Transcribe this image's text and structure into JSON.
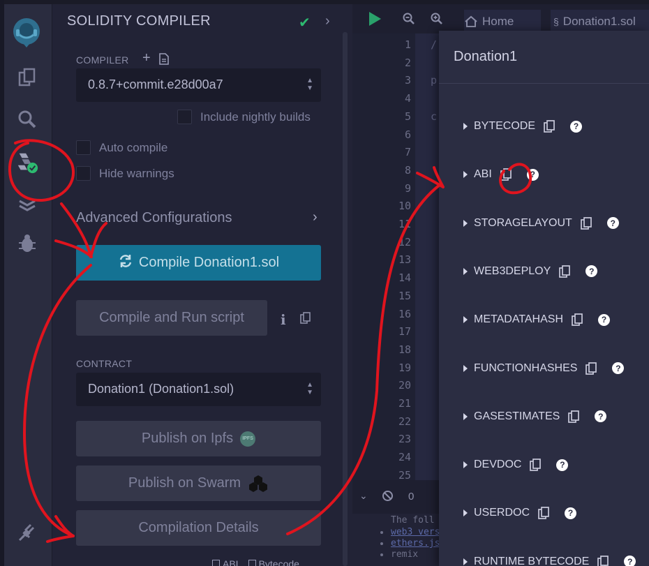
{
  "sidebar": {
    "icons": [
      "remix-logo-icon",
      "file-explorer-icon",
      "search-icon",
      "solidity-compiler-icon",
      "deploy-run-icon",
      "debugger-icon",
      "plugin-manager-icon"
    ]
  },
  "compiler_panel": {
    "title": "SOLIDITY COMPILER",
    "compiler_label": "COMPILER",
    "compiler_version": "0.8.7+commit.e28d00a7",
    "include_nightly_label": "Include nightly builds",
    "auto_compile_label": "Auto compile",
    "hide_warnings_label": "Hide warnings",
    "advanced_label": "Advanced Configurations",
    "compile_button": "Compile Donation1.sol",
    "compile_run_button": "Compile and Run script",
    "contract_label": "CONTRACT",
    "contract_value": "Donation1 (Donation1.sol)",
    "publish_ipfs_button": "Publish on Ipfs",
    "ipfs_badge": "IPFS",
    "publish_swarm_button": "Publish on Swarm",
    "compilation_details_button": "Compilation Details",
    "footer_abi": "ABI",
    "footer_bytecode": "Bytecode"
  },
  "editor": {
    "home_tab": "Home",
    "file_tab": "Donation1.sol",
    "line_numbers": [
      "1",
      "2",
      "3",
      "4",
      "5",
      "6",
      "7",
      "8",
      "9",
      "10",
      "11",
      "12",
      "13",
      "14",
      "15",
      "16",
      "17",
      "18",
      "19",
      "20",
      "21",
      "22",
      "23",
      "24",
      "25"
    ],
    "code_fragments": [
      "/",
      "p",
      "c"
    ],
    "terminal_count": "0",
    "terminal_lines": [
      "The foll",
      "web3 vers",
      "ethers.js",
      "remix"
    ]
  },
  "modal": {
    "title": "Donation1",
    "help_glyph": "?",
    "rows": [
      "BYTECODE",
      "ABI",
      "STORAGELAYOUT",
      "WEB3DEPLOY",
      "METADATAHASH",
      "FUNCTIONHASHES",
      "GASESTIMATES",
      "DEVDOC",
      "USERDOC",
      "RUNTIME BYTECODE"
    ]
  },
  "colors": {
    "accent_primary": "#147293",
    "success_check": "#2dba70",
    "annotation_red": "#e0141e",
    "modal_bg": "#2b2d42"
  }
}
